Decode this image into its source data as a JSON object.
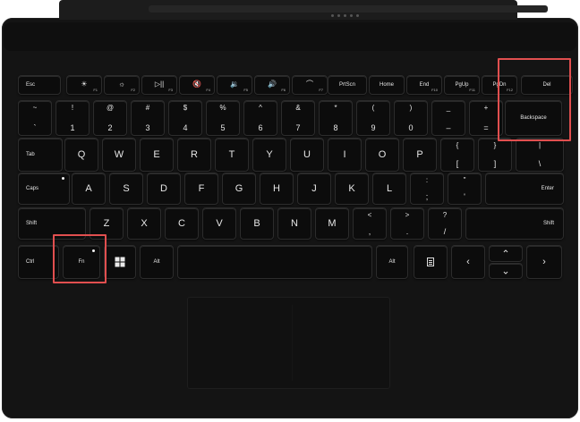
{
  "row_fn": [
    {
      "main": "Esc",
      "fn": ""
    },
    {
      "main": "",
      "fn": "F1",
      "icon": "brightness-down-icon",
      "glyph": "☀"
    },
    {
      "main": "",
      "fn": "F2",
      "icon": "brightness-up-icon",
      "glyph": "☼"
    },
    {
      "main": "",
      "fn": "F3",
      "icon": "play-pause-icon",
      "glyph": "▷||"
    },
    {
      "main": "",
      "fn": "F4",
      "icon": "mute-icon",
      "glyph": "🔇"
    },
    {
      "main": "",
      "fn": "F5",
      "icon": "volume-down-icon",
      "glyph": "🔉"
    },
    {
      "main": "",
      "fn": "F6",
      "icon": "volume-up-icon",
      "glyph": "🔊"
    },
    {
      "main": "",
      "fn": "F7",
      "icon": "backlight-icon",
      "glyph": "⌒"
    },
    {
      "main": "PrtScn",
      "fn": ""
    },
    {
      "main": "Home",
      "fn": ""
    },
    {
      "main": "End",
      "fn": "F10"
    },
    {
      "main": "PgUp",
      "fn": "F11"
    },
    {
      "main": "PgDn",
      "fn": "F12"
    },
    {
      "main": "Del",
      "fn": ""
    }
  ],
  "row_num": [
    {
      "top": "~",
      "bot": "`"
    },
    {
      "top": "!",
      "bot": "1"
    },
    {
      "top": "@",
      "bot": "2"
    },
    {
      "top": "#",
      "bot": "3"
    },
    {
      "top": "$",
      "bot": "4"
    },
    {
      "top": "%",
      "bot": "5"
    },
    {
      "top": "^",
      "bot": "6"
    },
    {
      "top": "&",
      "bot": "7"
    },
    {
      "top": "*",
      "bot": "8"
    },
    {
      "top": "(",
      "bot": "9"
    },
    {
      "top": ")",
      "bot": "0"
    },
    {
      "top": "_",
      "bot": "–"
    },
    {
      "top": "+",
      "bot": "="
    },
    {
      "main": "Backspace"
    }
  ],
  "row_q": {
    "tab": "Tab",
    "letters": [
      "Q",
      "W",
      "E",
      "R",
      "T",
      "Y",
      "U",
      "I",
      "O",
      "P"
    ],
    "extra": [
      {
        "top": "{",
        "bot": "["
      },
      {
        "top": "}",
        "bot": "]"
      },
      {
        "top": "|",
        "bot": "\\"
      }
    ]
  },
  "row_a": {
    "caps": "Caps",
    "letters": [
      "A",
      "S",
      "D",
      "F",
      "G",
      "H",
      "J",
      "K",
      "L"
    ],
    "extra": [
      {
        "top": ":",
        "bot": ";"
      },
      {
        "top": "\"",
        "bot": "'"
      }
    ],
    "enter": "Enter"
  },
  "row_z": {
    "shift_l": "Shift",
    "letters": [
      "Z",
      "X",
      "C",
      "V",
      "B",
      "N",
      "M"
    ],
    "extra": [
      {
        "top": "<",
        "bot": ","
      },
      {
        "top": ">",
        "bot": "."
      },
      {
        "top": "?",
        "bot": "/"
      }
    ],
    "shift_r": "Shift"
  },
  "row_bottom": {
    "ctrl": "Ctrl",
    "fn": "Fn",
    "alt_l": "Alt",
    "alt_r": "Alt",
    "left": "‹",
    "right": "›",
    "up": "⌃",
    "down": "⌄"
  },
  "colors": {
    "highlight": "#e14f4f",
    "keyboard": "#141414",
    "key": "#0c0c0c"
  }
}
